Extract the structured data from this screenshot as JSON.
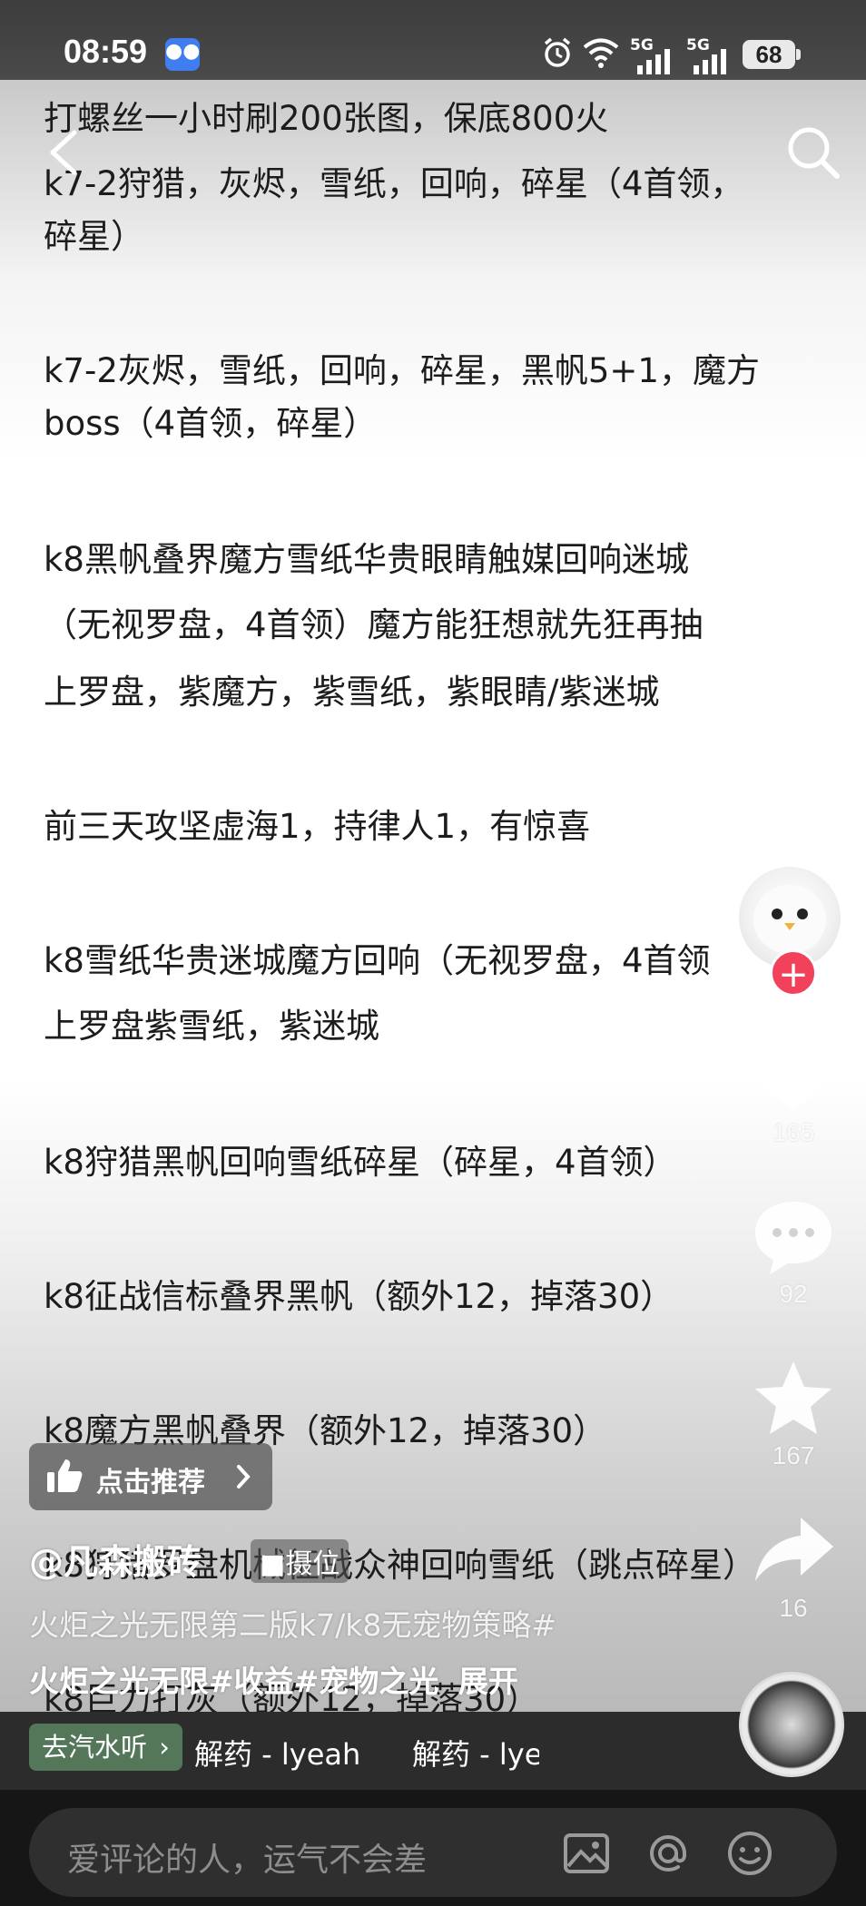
{
  "status_bar": {
    "time": "08:59",
    "chat_icon": "chat-bubble-icon",
    "network_1": "5G",
    "network_2": "5G",
    "battery": "68"
  },
  "post": {
    "lines": [
      "打螺丝一小时刷200张图，保底800火",
      "k7-2狩猎，灰烬，雪纸，回响，碎星（4首领，",
      "碎星）",
      "k7-2灰烬，雪纸，回响，碎星，黑帆5+1，魔方",
      "boss（4首领，碎星）",
      "k8黑帆叠界魔方雪纸华贵眼睛触媒回响迷城",
      "（无视罗盘，4首领）魔方能狂想就先狂再抽",
      "上罗盘，紫魔方，紫雪纸，紫眼睛/紫迷城",
      "前三天攻坚虚海1，持律人1，有惊喜",
      "k8雪纸华贵迷城魔方回响（无视罗盘，4首领",
      "上罗盘紫雪纸，紫迷城",
      "k8狩猎黑帆回响雪纸碎星（碎星，4首领）",
      "k8征战信标叠界黑帆（额外12，掉落30）",
      "k8魔方黑帆叠界（额外12，掉落30）",
      "k8狩猎罗盘机械征战众神回响雪纸（跳点碎星）",
      "k8巨力打灰（额外12，掉落30）"
    ]
  },
  "actions": {
    "like_count": "165",
    "comment_count": "92",
    "favorite_count": "167",
    "share_count": "16"
  },
  "recommend": {
    "label": "点击推荐"
  },
  "caption": {
    "author": "@凡森搬砖",
    "author_tag": "■摄位",
    "line1": "火炬之光无限第二版k7/k8无宠物策略#",
    "line2": "火炬之光无限#收益#宠物之光",
    "expand": "展开"
  },
  "music": {
    "chip_label": "去汽水听",
    "title": "解药 - lyeah",
    "title_repeat": "解药 - lyeah"
  },
  "comment": {
    "placeholder": "爱评论的人，运气不会差"
  },
  "colors": {
    "accent_red": "#f2415b",
    "music_chip": "#54775a"
  }
}
